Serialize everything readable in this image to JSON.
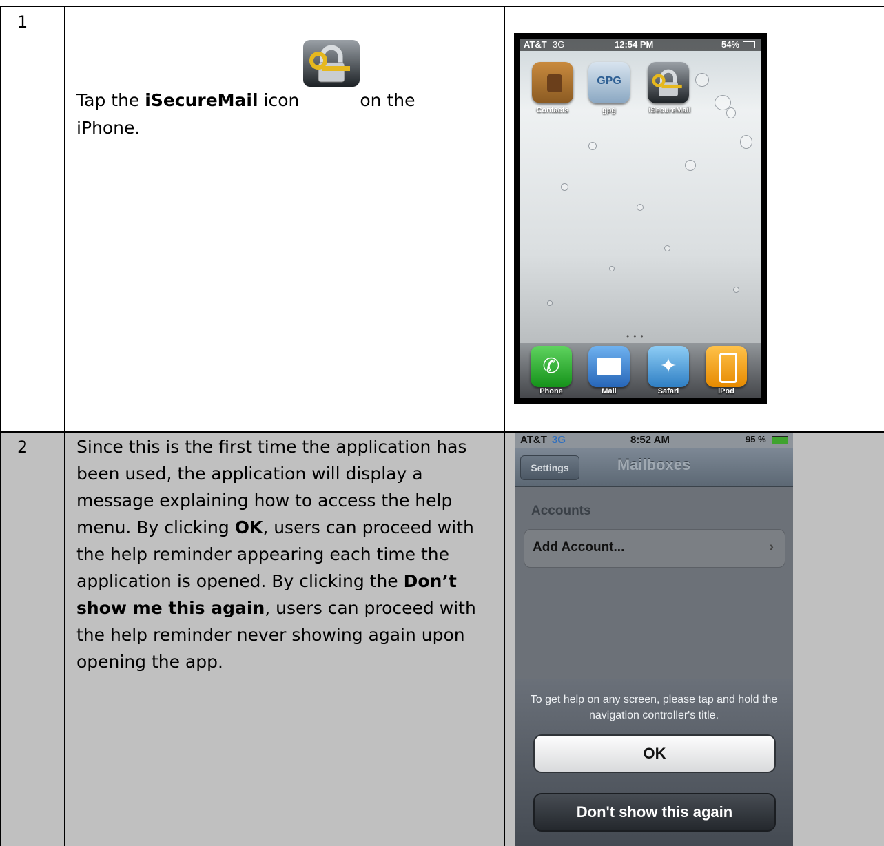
{
  "rows": [
    {
      "number": "1",
      "text": {
        "part1": "Tap the ",
        "bold1": "iSecureMail",
        "part2": " icon",
        "part3": "on the",
        "line2": "iPhone."
      },
      "screenshot": {
        "status": {
          "carrier": "AT&T",
          "network": "3G",
          "time": "12:54 PM",
          "battery": "54%"
        },
        "apps": [
          {
            "label": "Contacts",
            "icon": "contacts-icon"
          },
          {
            "label": "gpg",
            "icon": "gpg-icon",
            "glyph": "GPG"
          },
          {
            "label": "iSecureMail",
            "icon": "isecuremail-icon"
          }
        ],
        "dock": [
          {
            "label": "Phone",
            "icon": "phone-icon"
          },
          {
            "label": "Mail",
            "icon": "mail-icon"
          },
          {
            "label": "Safari",
            "icon": "safari-icon"
          },
          {
            "label": "iPod",
            "icon": "ipod-icon"
          }
        ]
      }
    },
    {
      "number": "2",
      "text": {
        "l1": "Since this is the first time the application has",
        "l2": "been used, the application will display a",
        "l3": "message explaining how to access the help",
        "l4a": "menu.  By clicking ",
        "l4b": "OK",
        "l4c": ", users can proceed with",
        "l5": "the help reminder appearing each time the",
        "l6a": "application is opened.  By clicking the ",
        "l6b": "Don’t",
        "l7a": "show me this again",
        "l7b": ", users can proceed with",
        "l8": "the help reminder never showing again upon",
        "l9": "opening the app."
      },
      "screenshot": {
        "status": {
          "carrier": "AT&T",
          "network": "3G",
          "time": "8:52 AM",
          "battery": "95 %"
        },
        "nav_button": "Settings",
        "nav_title": "Mailboxes",
        "section": "Accounts",
        "row": "Add Account...",
        "alert_message": "To get help on any screen, please tap and hold the navigation controller's title.",
        "ok": "OK",
        "dont_show": "Don't show this again"
      }
    }
  ],
  "colors": {
    "row2_bg": "#c0c0c0",
    "border": "#000000"
  }
}
